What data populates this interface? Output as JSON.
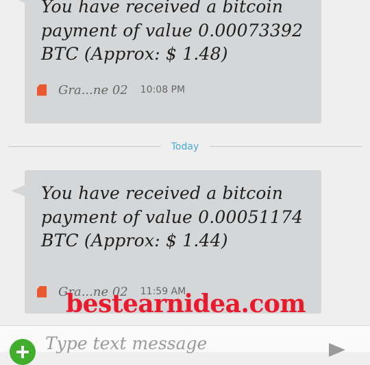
{
  "messages": [
    {
      "text": "You have received a bitcoin payment of value 0.00073392 BTC (Approx: $ 1.48)",
      "sender": "Gra...ne 02",
      "time": "10:08 PM"
    },
    {
      "text": "You have received a bitcoin payment of value 0.00051174 BTC (Approx: $ 1.44)",
      "sender": "Gra...ne 02",
      "time": "11:59 AM"
    }
  ],
  "divider": {
    "label": "Today"
  },
  "watermark": {
    "text": "bestearnidea.com",
    "color": "#e81a2c"
  },
  "compose": {
    "placeholder": "Type text message"
  },
  "icons": {
    "sim": "sim-card-icon",
    "add": "add-attachment-icon",
    "send": "send-icon"
  },
  "colors": {
    "bubble": "#d4d6d8",
    "divider_label": "#4aa8d8",
    "add_button": "#3fae2a",
    "sim_icon": "#e85a2e"
  }
}
